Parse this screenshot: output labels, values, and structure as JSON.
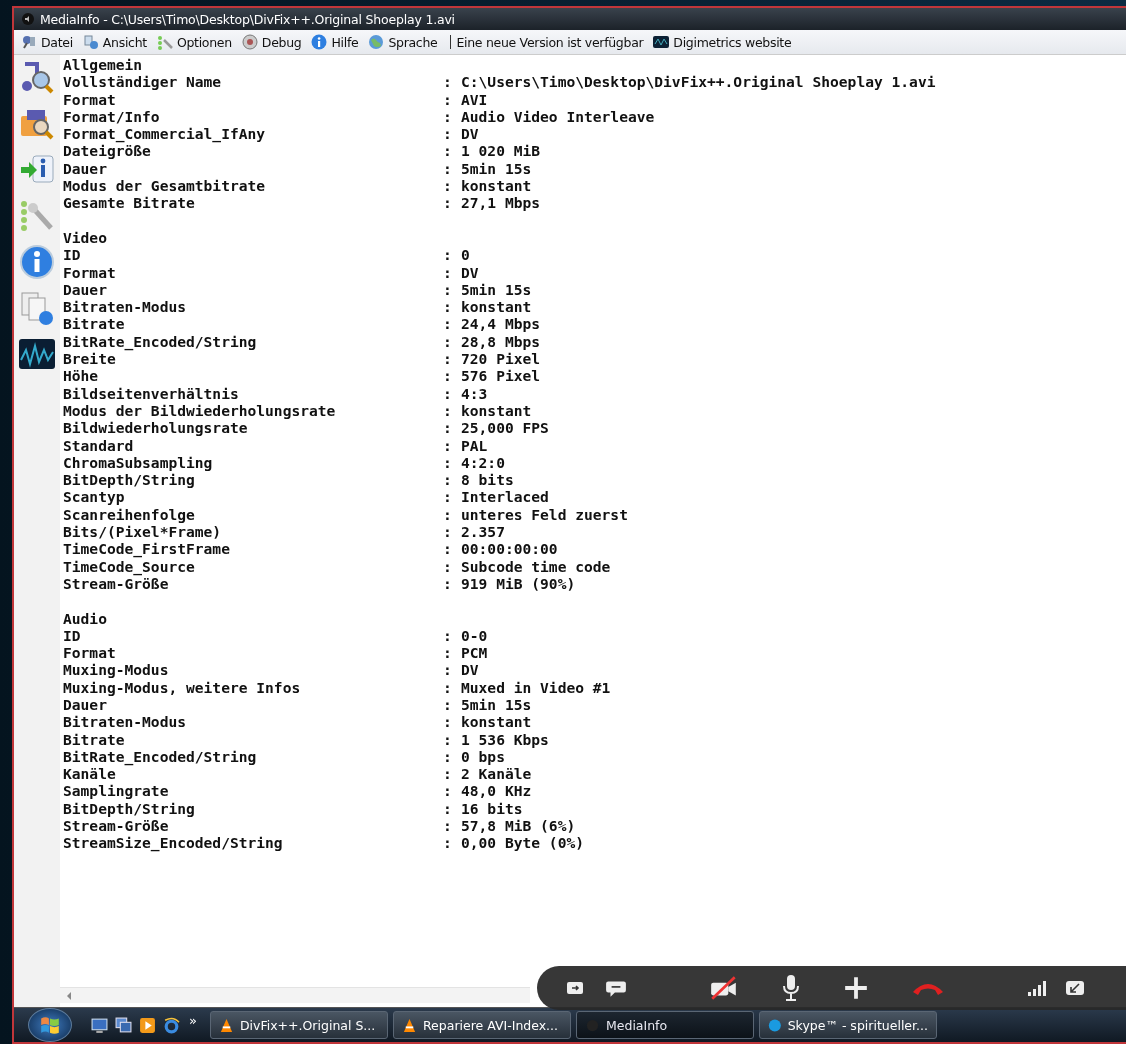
{
  "window": {
    "title": "MediaInfo - C:\\Users\\Timo\\Desktop\\DivFix++.Original Shoeplay 1.avi"
  },
  "menu": [
    {
      "label": "Datei",
      "kind": "file"
    },
    {
      "label": "Ansicht",
      "kind": "view"
    },
    {
      "label": "Optionen",
      "kind": "options"
    },
    {
      "label": "Debug",
      "kind": "debug"
    },
    {
      "label": "Hilfe",
      "kind": "help"
    },
    {
      "label": "Sprache",
      "kind": "language"
    },
    {
      "label": "Eine neue Version ist verfügbar",
      "kind": "plain"
    },
    {
      "label": "Digimetrics website",
      "kind": "web"
    }
  ],
  "toolbar": [
    {
      "kind": "music-search"
    },
    {
      "kind": "folder-search"
    },
    {
      "kind": "info-arrow"
    },
    {
      "kind": "wrench"
    },
    {
      "kind": "info"
    },
    {
      "kind": "documents"
    },
    {
      "kind": "waveform"
    }
  ],
  "separator": ":",
  "sections": [
    {
      "title": "Allgemein",
      "rows": [
        {
          "key": "Vollständiger Name",
          "value": "C:\\Users\\Timo\\Desktop\\DivFix++.Original Shoeplay 1.avi"
        },
        {
          "key": "Format",
          "value": "AVI"
        },
        {
          "key": "Format/Info",
          "value": "Audio Video Interleave"
        },
        {
          "key": "Format_Commercial_IfAny",
          "value": "DV"
        },
        {
          "key": "Dateigröße",
          "value": "1 020 MiB"
        },
        {
          "key": "Dauer",
          "value": "5min 15s"
        },
        {
          "key": "Modus der Gesamtbitrate",
          "value": "konstant"
        },
        {
          "key": "Gesamte Bitrate",
          "value": "27,1 Mbps"
        }
      ]
    },
    {
      "title": "Video",
      "rows": [
        {
          "key": "ID",
          "value": "0"
        },
        {
          "key": "Format",
          "value": "DV"
        },
        {
          "key": "Dauer",
          "value": "5min 15s"
        },
        {
          "key": "Bitraten-Modus",
          "value": "konstant"
        },
        {
          "key": "Bitrate",
          "value": "24,4 Mbps"
        },
        {
          "key": "BitRate_Encoded/String",
          "value": "28,8 Mbps"
        },
        {
          "key": "Breite",
          "value": "720 Pixel"
        },
        {
          "key": "Höhe",
          "value": "576 Pixel"
        },
        {
          "key": "Bildseitenverhältnis",
          "value": "4:3"
        },
        {
          "key": "Modus der Bildwiederholungsrate",
          "value": "konstant"
        },
        {
          "key": "Bildwiederholungsrate",
          "value": "25,000 FPS"
        },
        {
          "key": "Standard",
          "value": "PAL"
        },
        {
          "key": "ChromaSubsampling",
          "value": "4:2:0"
        },
        {
          "key": "BitDepth/String",
          "value": "8 bits"
        },
        {
          "key": "Scantyp",
          "value": "Interlaced"
        },
        {
          "key": "Scanreihenfolge",
          "value": "unteres Feld zuerst"
        },
        {
          "key": "Bits/(Pixel*Frame)",
          "value": "2.357"
        },
        {
          "key": "TimeCode_FirstFrame",
          "value": "00:00:00:00"
        },
        {
          "key": "TimeCode_Source",
          "value": "Subcode time code"
        },
        {
          "key": "Stream-Größe",
          "value": "919 MiB (90%)"
        }
      ]
    },
    {
      "title": "Audio",
      "rows": [
        {
          "key": "ID",
          "value": "0-0"
        },
        {
          "key": "Format",
          "value": "PCM"
        },
        {
          "key": "Muxing-Modus",
          "value": "DV"
        },
        {
          "key": "Muxing-Modus, weitere Infos",
          "value": "Muxed in Video #1"
        },
        {
          "key": "Dauer",
          "value": "5min 15s"
        },
        {
          "key": "Bitraten-Modus",
          "value": "konstant"
        },
        {
          "key": "Bitrate",
          "value": "1 536 Kbps"
        },
        {
          "key": "BitRate_Encoded/String",
          "value": "0 bps"
        },
        {
          "key": "Kanäle",
          "value": "2 Kanäle"
        },
        {
          "key": "Samplingrate",
          "value": "48,0 KHz"
        },
        {
          "key": "BitDepth/String",
          "value": "16 bits"
        },
        {
          "key": "Stream-Größe",
          "value": "57,8 MiB (6%)"
        },
        {
          "key": "StreamSize_Encoded/String",
          "value": "0,00 Byte (0%)"
        }
      ]
    }
  ],
  "taskbar": {
    "quick_launch_more": "»",
    "tasks": [
      {
        "label": "DivFix++.Original S...",
        "kind": "vlc",
        "selected": false
      },
      {
        "label": "Repariere AVI-Index...",
        "kind": "vlc",
        "selected": false
      },
      {
        "label": "MediaInfo",
        "kind": "mediainfo",
        "selected": true
      },
      {
        "label": "Skype™ - spiritueller...",
        "kind": "skype",
        "selected": false
      }
    ]
  },
  "call_controls": [
    {
      "kind": "share"
    },
    {
      "kind": "chat"
    },
    {
      "kind": "video-off"
    },
    {
      "kind": "mic"
    },
    {
      "kind": "add"
    },
    {
      "kind": "hangup"
    },
    {
      "kind": "signal"
    },
    {
      "kind": "minimize"
    }
  ]
}
